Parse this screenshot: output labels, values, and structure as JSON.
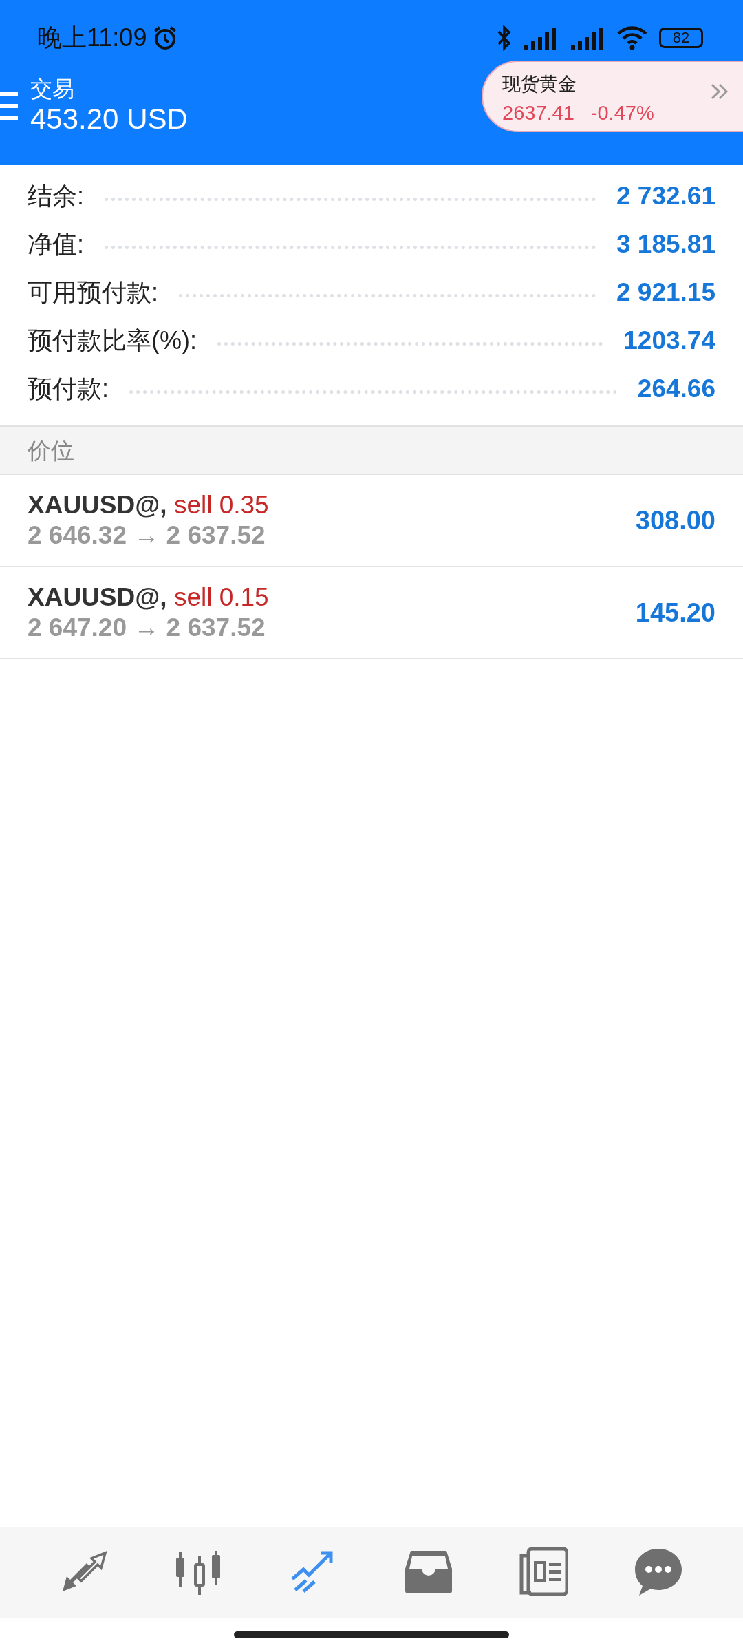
{
  "status_bar": {
    "time": "晚上11:09",
    "battery": "82"
  },
  "header": {
    "title": "交易",
    "balance": "453.20 USD"
  },
  "ticker_widget": {
    "name": "现货黄金",
    "price": "2637.41",
    "change": "-0.47%"
  },
  "account": [
    {
      "label": "结余:",
      "value": "2 732.61"
    },
    {
      "label": "净值:",
      "value": "3 185.81"
    },
    {
      "label": "可用预付款:",
      "value": "2 921.15"
    },
    {
      "label": "预付款比率(%):",
      "value": "1203.74"
    },
    {
      "label": "预付款:",
      "value": "264.66"
    }
  ],
  "section": {
    "title": "价位"
  },
  "positions": [
    {
      "symbol": "XAUUSD@,",
      "side": "sell 0.35",
      "prices": "2 646.32 → 2 637.52",
      "profit": "308.00"
    },
    {
      "symbol": "XAUUSD@,",
      "side": "sell 0.15",
      "prices": "2 647.20 → 2 637.52",
      "profit": "145.20"
    }
  ],
  "bottom_nav": [
    {
      "kind": "quotes",
      "selected": false
    },
    {
      "kind": "chart",
      "selected": false
    },
    {
      "kind": "trade",
      "selected": true
    },
    {
      "kind": "history",
      "selected": false
    },
    {
      "kind": "news",
      "selected": false
    },
    {
      "kind": "chat",
      "selected": false
    }
  ]
}
